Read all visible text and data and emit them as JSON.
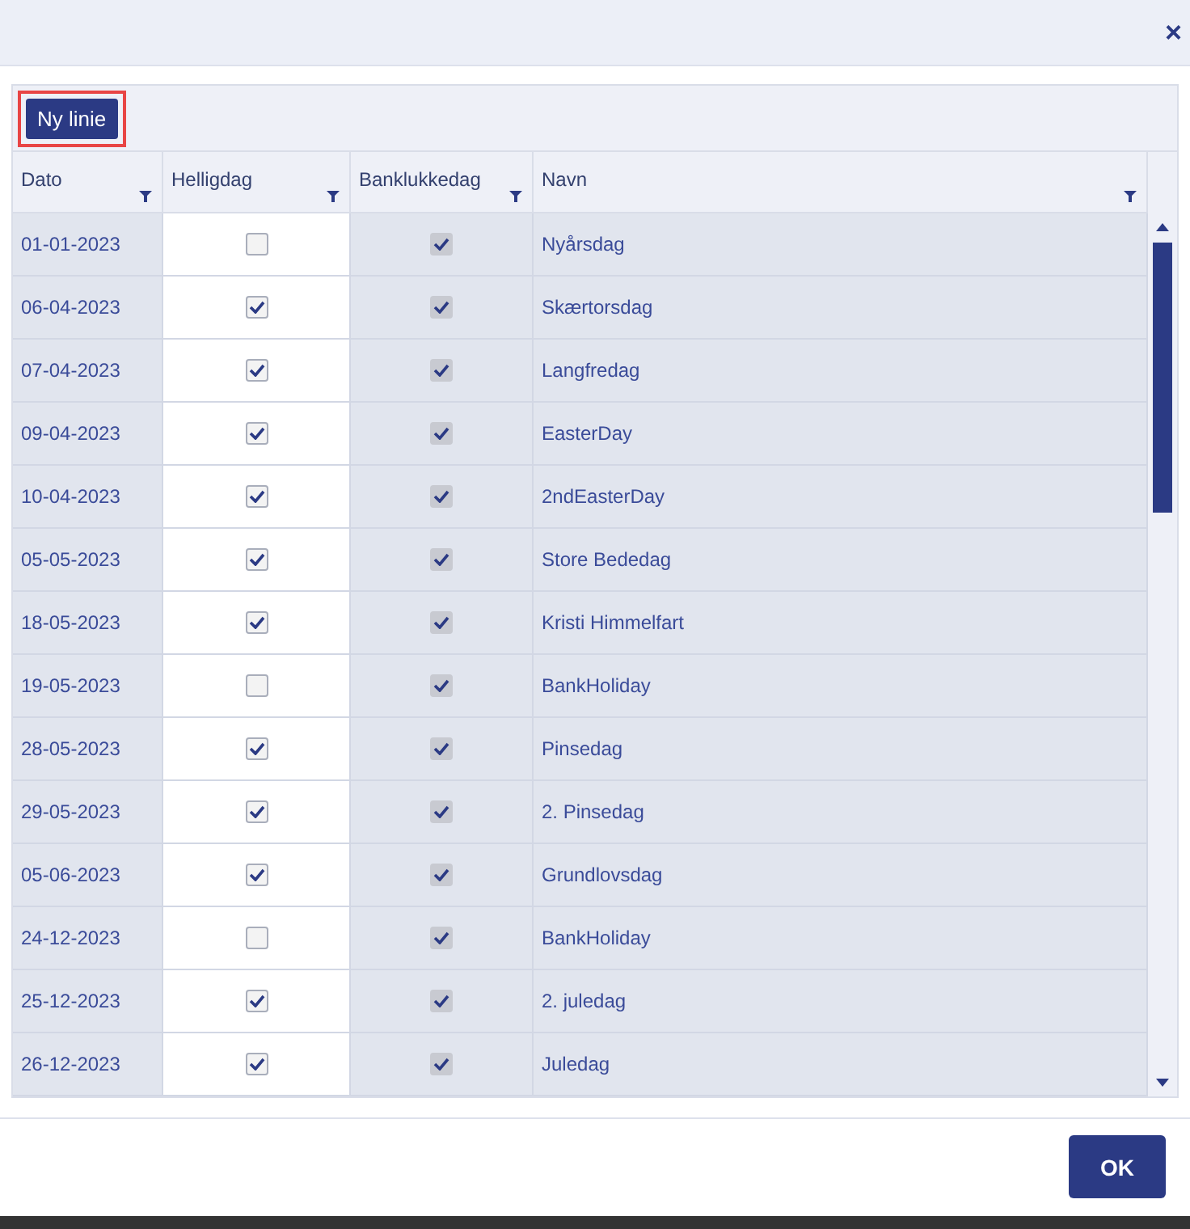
{
  "dialog": {
    "close": "×"
  },
  "toolbar": {
    "new_button": {
      "label": "Ny linie",
      "highlighted": true
    }
  },
  "columns": [
    {
      "label": "Dato",
      "editable": false
    },
    {
      "label": "Helligdag",
      "editable": true
    },
    {
      "label": "Banklukkedag",
      "editable": false
    },
    {
      "label": "Navn",
      "editable": false
    }
  ],
  "rows": [
    {
      "date": "01-01-2023",
      "holiday": false,
      "bank_closed": true,
      "name": "Nyårsdag"
    },
    {
      "date": "06-04-2023",
      "holiday": true,
      "bank_closed": true,
      "name": "Skærtorsdag"
    },
    {
      "date": "07-04-2023",
      "holiday": true,
      "bank_closed": true,
      "name": "Langfredag"
    },
    {
      "date": "09-04-2023",
      "holiday": true,
      "bank_closed": true,
      "name": "EasterDay"
    },
    {
      "date": "10-04-2023",
      "holiday": true,
      "bank_closed": true,
      "name": "2ndEasterDay"
    },
    {
      "date": "05-05-2023",
      "holiday": true,
      "bank_closed": true,
      "name": "Store Bededag"
    },
    {
      "date": "18-05-2023",
      "holiday": true,
      "bank_closed": true,
      "name": "Kristi Himmelfart"
    },
    {
      "date": "19-05-2023",
      "holiday": false,
      "bank_closed": true,
      "name": "BankHoliday"
    },
    {
      "date": "28-05-2023",
      "holiday": true,
      "bank_closed": true,
      "name": "Pinsedag"
    },
    {
      "date": "29-05-2023",
      "holiday": true,
      "bank_closed": true,
      "name": "2. Pinsedag"
    },
    {
      "date": "05-06-2023",
      "holiday": true,
      "bank_closed": true,
      "name": "Grundlovsdag"
    },
    {
      "date": "24-12-2023",
      "holiday": false,
      "bank_closed": true,
      "name": "BankHoliday"
    },
    {
      "date": "25-12-2023",
      "holiday": true,
      "bank_closed": true,
      "name": "2. juledag"
    },
    {
      "date": "26-12-2023",
      "holiday": true,
      "bank_closed": true,
      "name": "Juledag"
    }
  ],
  "footer": {
    "ok_button": "OK"
  }
}
